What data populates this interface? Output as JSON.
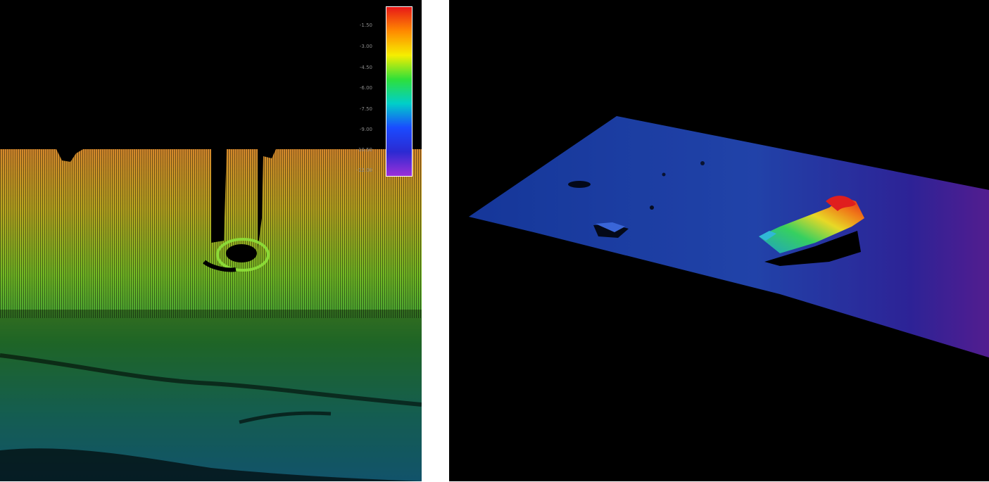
{
  "left_panel": {
    "colorbar": {
      "ticks": [
        "-1.50",
        "-3.00",
        "-4.50",
        "-6.00",
        "-7.50",
        "-9.00",
        "-10.50",
        "-12.00"
      ],
      "colors": [
        "#e81818",
        "#ff8a00",
        "#f6ee00",
        "#2ee03a",
        "#00cfc9",
        "#1a4bff",
        "#2b2ad2",
        "#9b2fd8"
      ]
    },
    "gradient": [
      "#d5882b",
      "#b8a520",
      "#72b824",
      "#2f9b3a",
      "#1f8f7c",
      "#1a7fa3"
    ]
  },
  "right_panel": {
    "surface_colors": [
      "#1b46c4",
      "#2a55d8",
      "#3a2cc0",
      "#6a25b8"
    ],
    "object_colors": [
      "#1ea0c8",
      "#36d060",
      "#e8d826",
      "#f07a18",
      "#e01e1e"
    ]
  }
}
